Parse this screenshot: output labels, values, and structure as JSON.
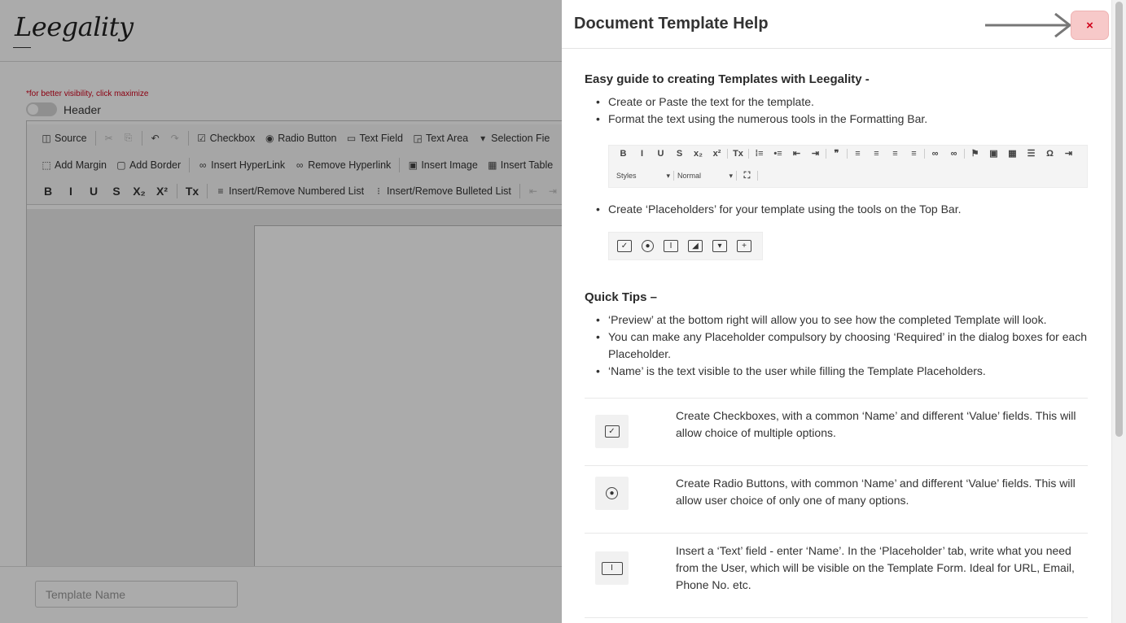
{
  "background": {
    "logo": "Leegality",
    "hint": "*for better visibility, click maximize",
    "header_label": "Header",
    "toolbar_row1": [
      {
        "label": "Source",
        "icon": "◫",
        "name": "source-button",
        "disabled": false
      },
      {
        "label": "",
        "icon": "✂",
        "name": "cut-button",
        "disabled": true
      },
      {
        "label": "",
        "icon": "⎘",
        "name": "copy-button",
        "disabled": true
      },
      {
        "label": "",
        "icon": "↶",
        "name": "undo-button",
        "disabled": false
      },
      {
        "label": "",
        "icon": "↷",
        "name": "redo-button",
        "disabled": true
      },
      {
        "label": "Checkbox",
        "icon": "☑",
        "name": "checkbox-button",
        "disabled": false
      },
      {
        "label": "Radio Button",
        "icon": "◉",
        "name": "radio-button-button",
        "disabled": false
      },
      {
        "label": "Text Field",
        "icon": "▭",
        "name": "text-field-button",
        "disabled": false
      },
      {
        "label": "Text Area",
        "icon": "◲",
        "name": "text-area-button",
        "disabled": false
      },
      {
        "label": "Selection Fie",
        "icon": "▾",
        "name": "selection-field-button",
        "disabled": false
      }
    ],
    "toolbar_row2": [
      {
        "label": "Add Margin",
        "icon": "⬚",
        "name": "add-margin-button",
        "disabled": false
      },
      {
        "label": "Add Border",
        "icon": "▢",
        "name": "add-border-button",
        "disabled": false
      },
      {
        "label": "Insert HyperLink",
        "icon": "∞",
        "name": "insert-hyperlink-button",
        "disabled": false
      },
      {
        "label": "Remove Hyperlink",
        "icon": "∞",
        "name": "remove-hyperlink-button",
        "disabled": false
      },
      {
        "label": "Insert Image",
        "icon": "▣",
        "name": "insert-image-button",
        "disabled": false
      },
      {
        "label": "Insert Table",
        "icon": "▦",
        "name": "insert-table-button",
        "disabled": false
      }
    ],
    "toolbar_row3_formats": [
      "B",
      "I",
      "U",
      "S",
      "X₂",
      "X²",
      "Tx"
    ],
    "toolbar_row3": [
      {
        "label": "Insert/Remove Numbered List",
        "icon": "≡",
        "name": "numbered-list-button"
      },
      {
        "label": "Insert/Remove Bulleted List",
        "icon": "⁝",
        "name": "bulleted-list-button"
      }
    ],
    "template_name_placeholder": "Template Name"
  },
  "panel": {
    "title": "Document Template Help",
    "close_label": "×",
    "guide_title": "Easy guide to creating Templates with Leegality -",
    "guide_bullets": [
      "Create or Paste the text for the template.",
      "Format the text using the numerous tools in the Formatting Bar."
    ],
    "placeholder_bullet": "Create ‘Placeholders’ for your template using the tools on the Top Bar.",
    "format_bar_icons": [
      "B",
      "I",
      "U",
      "S",
      "x₂",
      "x²",
      "Tx",
      "⁞≡",
      "•≡",
      "⇤",
      "⇥",
      "❞",
      "≡",
      "≡",
      "≡",
      "≡",
      "∞",
      "∞",
      "⚑",
      "▣",
      "▦",
      "☰",
      "Ω",
      "⇥"
    ],
    "format_bar_styles": "Styles",
    "format_bar_normal": "Normal",
    "tips_title": "Quick Tips –",
    "tips": [
      "‘Preview’ at the bottom right will allow you to see how the completed Template will look.",
      "You can make any Placeholder compulsory by choosing ‘Required’ in the dialog boxes for each Placeholder.",
      "‘Name’ is the text visible to the user while filling the Template Placeholders."
    ],
    "rows": [
      {
        "icon": "checkbox-icon",
        "text": "Create Checkboxes, with a common ‘Name’ and different ‘Value’ fields. This will allow choice of multiple options."
      },
      {
        "icon": "radio-icon",
        "text": "Create Radio Buttons, with common ‘Name’ and different ‘Value’ fields. This will allow user choice of only one of many options."
      },
      {
        "icon": "text-field-icon",
        "text": "Insert a ‘Text’ field - enter ‘Name’. In the ‘Placeholder’ tab, write what you need from the User, which will be visible on the Template Form. Ideal for URL, Email, Phone No. etc."
      }
    ]
  },
  "colors": {
    "close_bg": "#f7c9c9",
    "close_fg": "#d0021b",
    "hint_red": "#d0021b"
  }
}
